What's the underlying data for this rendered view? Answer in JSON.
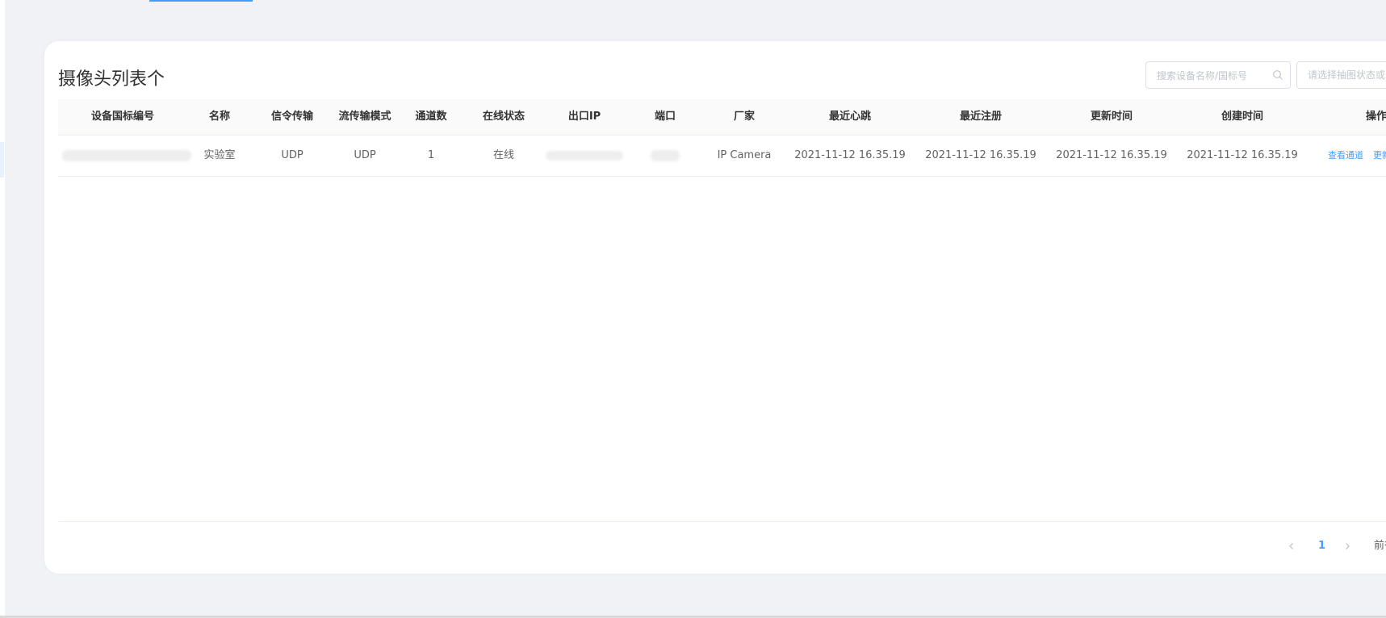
{
  "page": {
    "title": "摄像头列表个"
  },
  "search": {
    "placeholder": "搜索设备名称/国标号"
  },
  "filter": {
    "placeholder": "请选择抽图状态或"
  },
  "table": {
    "columns": [
      "设备国标编号",
      "名称",
      "信令传输",
      "流传输模式",
      "通道数",
      "在线状态",
      "出口IP",
      "端口",
      "厂家",
      "最近心跳",
      "最近注册",
      "更新时间",
      "创建时间",
      "操作"
    ],
    "rows": [
      {
        "device_id": "",
        "name": "实验室",
        "signal_transport": "UDP",
        "stream_mode": "UDP",
        "channel_count": "1",
        "online_status": "在线",
        "ip": "",
        "port": "",
        "manufacturer": "IP Camera",
        "last_heartbeat": "2021-11-12 16.35.19",
        "last_register": "2021-11-12 16.35.19",
        "update_time": "2021-11-12 16.35.19",
        "create_time": "2021-11-12 16.35.19",
        "actions": [
          "查看通道",
          "更新"
        ]
      }
    ]
  },
  "pagination": {
    "current_page": "1",
    "goto_label": "前往"
  },
  "colors": {
    "accent": "#409eff",
    "background": "#f0f2f5"
  }
}
